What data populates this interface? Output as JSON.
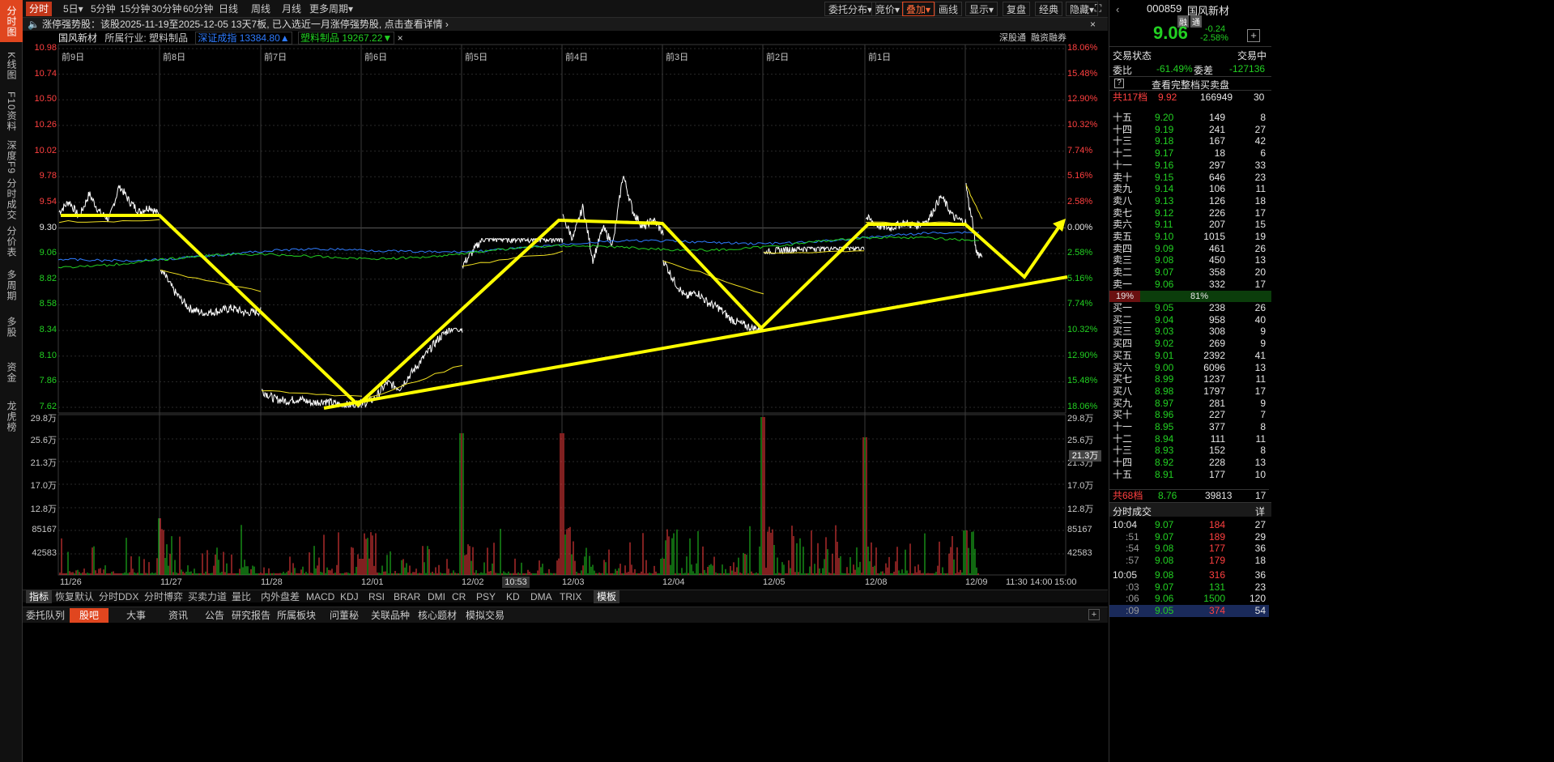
{
  "leftnav": {
    "items": [
      "分时图",
      "K线图",
      "F10资料",
      "深度F9",
      "分时成交",
      "分价表",
      "多周期",
      "多股",
      "资金",
      "龙虎榜"
    ]
  },
  "topbar": {
    "periods": [
      "分时",
      "5日▾",
      "5分钟",
      "15分钟",
      "30分钟",
      "60分钟",
      "日线",
      "周线",
      "月线",
      "更多周期▾"
    ],
    "right": [
      "委托分布▾",
      "竞价▾",
      "叠加▾",
      "画线",
      "显示▾",
      "复盘",
      "经典",
      "隐藏▾"
    ]
  },
  "notice": {
    "text": "涨停强势股：该股2025-11-19至2025-12-05 13天7板, 已入选近一月涨停强势股, 点击查看详情 ›",
    "close": "×"
  },
  "infoline": {
    "name": "国风新材",
    "industry": "所属行业: 塑料制品",
    "index1": "深证成指 13384.80▲",
    "index2": "塑料制品 19267.22▼",
    "close": "×",
    "links": [
      "深股通",
      "融资融券"
    ]
  },
  "price_axis": {
    "left": [
      "10.98",
      "10.74",
      "10.50",
      "10.26",
      "10.02",
      "9.78",
      "9.54",
      "9.30",
      "9.06",
      "8.82",
      "8.58",
      "8.34",
      "8.10",
      "7.86",
      "7.62"
    ],
    "right": [
      "18.06%",
      "15.48%",
      "12.90%",
      "10.32%",
      "7.74%",
      "5.16%",
      "2.58%",
      "0.00%",
      "2.58%",
      "5.16%",
      "7.74%",
      "10.32%",
      "12.90%",
      "15.48%",
      "18.06%"
    ]
  },
  "day_labels": [
    "前9日",
    "前8日",
    "前7日",
    "前6日",
    "前5日",
    "前4日",
    "前3日",
    "前2日",
    "前1日"
  ],
  "vol_axis": {
    "left": [
      "29.8万",
      "25.6万",
      "21.3万",
      "17.0万",
      "12.8万",
      "85167",
      "42583"
    ],
    "right": [
      "29.8万",
      "25.6万",
      "21.3万",
      "17.0万",
      "12.8万",
      "85167",
      "42583"
    ],
    "cursor_value": "21.3万"
  },
  "x_labels": {
    "dates": [
      "11/26",
      "11/27",
      "11/28",
      "12/01",
      "12/02",
      "12/03",
      "12/04",
      "12/05",
      "12/08",
      "12/09"
    ],
    "time_cursor": "10:53",
    "times": [
      "11:30",
      "14:00",
      "15:00"
    ]
  },
  "indicators": {
    "items": [
      "指标",
      "恢复默认",
      "分时DDX",
      "分时博弈",
      "买卖力道",
      "量比",
      "内外盘差",
      "MACD",
      "KDJ",
      "RSI",
      "BRAR",
      "DMI",
      "CR",
      "PSY",
      "KD",
      "DMA",
      "TRIX",
      "模板"
    ]
  },
  "tabs": {
    "items": [
      "委托队列",
      "股吧",
      "大事",
      "资讯",
      "公告",
      "研究报告",
      "所属板块",
      "问董秘",
      "关联品种",
      "核心题材",
      "模拟交易"
    ],
    "active": 1
  },
  "quote": {
    "code": "000859",
    "name": "国风新材",
    "tags": [
      "融",
      "通"
    ],
    "price": "9.06",
    "change": "-0.24",
    "pct": "-2.58%",
    "status_label": "交易状态",
    "status": "交易中",
    "weibi_label": "委比",
    "weibi": "-61.49%",
    "weicha_label": "委差",
    "weicha": "-127136",
    "full_book": "查看完整档买卖盘",
    "top": {
      "label": "共117档",
      "price": "9.92",
      "vol": "166949",
      "cnt": "30"
    },
    "asks": [
      {
        "l": "十五",
        "p": "9.20",
        "v": "149",
        "c": "8"
      },
      {
        "l": "十四",
        "p": "9.19",
        "v": "241",
        "c": "27"
      },
      {
        "l": "十三",
        "p": "9.18",
        "v": "167",
        "c": "42"
      },
      {
        "l": "十二",
        "p": "9.17",
        "v": "18",
        "c": "6"
      },
      {
        "l": "十一",
        "p": "9.16",
        "v": "297",
        "c": "33"
      },
      {
        "l": "卖十",
        "p": "9.15",
        "v": "646",
        "c": "23"
      },
      {
        "l": "卖九",
        "p": "9.14",
        "v": "106",
        "c": "11"
      },
      {
        "l": "卖八",
        "p": "9.13",
        "v": "126",
        "c": "18"
      },
      {
        "l": "卖七",
        "p": "9.12",
        "v": "226",
        "c": "17"
      },
      {
        "l": "卖六",
        "p": "9.11",
        "v": "207",
        "c": "15"
      },
      {
        "l": "卖五",
        "p": "9.10",
        "v": "1015",
        "c": "19"
      },
      {
        "l": "卖四",
        "p": "9.09",
        "v": "461",
        "c": "26"
      },
      {
        "l": "卖三",
        "p": "9.08",
        "v": "450",
        "c": "13"
      },
      {
        "l": "卖二",
        "p": "9.07",
        "v": "358",
        "c": "20"
      },
      {
        "l": "卖一",
        "p": "9.06",
        "v": "332",
        "c": "17"
      }
    ],
    "ratio": {
      "sell": "19%",
      "buy": "81%"
    },
    "bids": [
      {
        "l": "买一",
        "p": "9.05",
        "v": "238",
        "c": "26"
      },
      {
        "l": "买二",
        "p": "9.04",
        "v": "958",
        "c": "40"
      },
      {
        "l": "买三",
        "p": "9.03",
        "v": "308",
        "c": "9"
      },
      {
        "l": "买四",
        "p": "9.02",
        "v": "269",
        "c": "9"
      },
      {
        "l": "买五",
        "p": "9.01",
        "v": "2392",
        "c": "41"
      },
      {
        "l": "买六",
        "p": "9.00",
        "v": "6096",
        "c": "13"
      },
      {
        "l": "买七",
        "p": "8.99",
        "v": "1237",
        "c": "11"
      },
      {
        "l": "买八",
        "p": "8.98",
        "v": "1797",
        "c": "17"
      },
      {
        "l": "买九",
        "p": "8.97",
        "v": "281",
        "c": "9"
      },
      {
        "l": "买十",
        "p": "8.96",
        "v": "227",
        "c": "7"
      },
      {
        "l": "十一",
        "p": "8.95",
        "v": "377",
        "c": "8"
      },
      {
        "l": "十二",
        "p": "8.94",
        "v": "111",
        "c": "11"
      },
      {
        "l": "十三",
        "p": "8.93",
        "v": "152",
        "c": "8"
      },
      {
        "l": "十四",
        "p": "8.92",
        "v": "228",
        "c": "13"
      },
      {
        "l": "十五",
        "p": "8.91",
        "v": "177",
        "c": "10"
      }
    ],
    "bottom": {
      "label": "共68档",
      "price": "8.76",
      "vol": "39813",
      "cnt": "17"
    },
    "trades_title": "分时成交",
    "trades_more": "详",
    "trades": [
      {
        "t": "10:04",
        "p": "9.07",
        "v": "184",
        "c": "27"
      },
      {
        "t": ":51",
        "p": "9.07",
        "v": "189",
        "c": "29"
      },
      {
        "t": ":54",
        "p": "9.08",
        "v": "177",
        "c": "36"
      },
      {
        "t": ":57",
        "p": "9.08",
        "v": "179",
        "c": "18"
      },
      {
        "t": "10:05",
        "p": "9.08",
        "v": "316",
        "c": "36"
      },
      {
        "t": ":03",
        "p": "9.07",
        "v": "131",
        "c": "23"
      },
      {
        "t": ":06",
        "p": "9.06",
        "v": "1500",
        "c": "120"
      },
      {
        "t": ":09",
        "p": "9.05",
        "v": "374",
        "c": "54"
      }
    ]
  },
  "colors": {
    "up": "#ff4040",
    "down": "#22d022",
    "price_line": "#ffffff",
    "avg_line": "#f0e020",
    "index_blue": "#2f7cff",
    "index_green": "#22d022",
    "annotation": "#ffff00",
    "accent": "#e0461f"
  }
}
